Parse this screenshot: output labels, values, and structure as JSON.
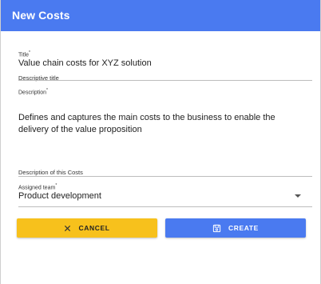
{
  "dialog": {
    "title": "New Costs"
  },
  "form": {
    "title_field": {
      "label": "Title",
      "required_mark": "*",
      "value": "Value chain costs for XYZ solution",
      "helper": "Descriptive title"
    },
    "description_field": {
      "label": "Description",
      "required_mark": "*",
      "value": "Defines and captures the main costs to the business to enable the delivery of the value proposition",
      "helper": "Description of this Costs"
    },
    "team_field": {
      "label": "Assigned team",
      "required_mark": "*",
      "value": "Product development"
    }
  },
  "actions": {
    "cancel_label": "CANCEL",
    "create_label": "CREATE"
  },
  "colors": {
    "header": "#4a7af0",
    "cancel_button": "#f7c11c",
    "create_button": "#4a7af0"
  },
  "icons": {
    "cancel": "close-icon",
    "create": "save-icon",
    "dropdown": "dropdown-arrow-icon"
  }
}
